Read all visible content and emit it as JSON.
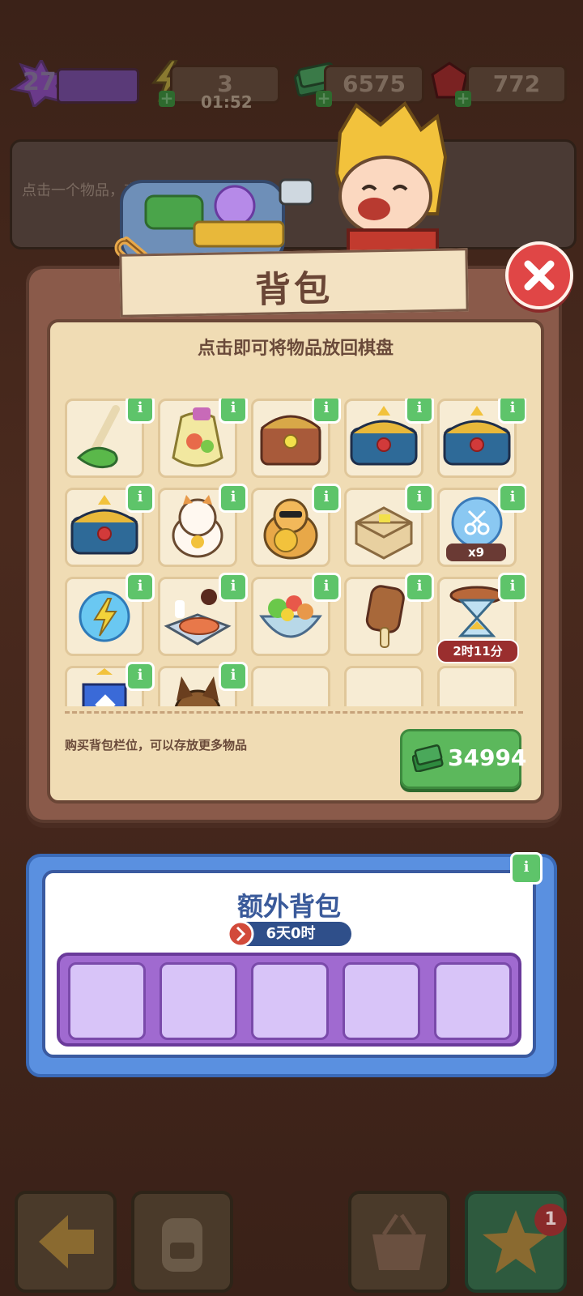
{
  "hud": {
    "level": "27",
    "energy": "3",
    "energy_timer": "01:52",
    "cash": "6575",
    "gems": "772"
  },
  "background_hint": "点击一个物品，查看它的信息",
  "backpack": {
    "title": "背包",
    "subtitle": "点击即可将物品放回棋盘",
    "info_label": "i",
    "items": [
      {
        "icon": "green-mop-icon"
      },
      {
        "icon": "seed-bag-icon"
      },
      {
        "icon": "treasure-chest-icon"
      },
      {
        "icon": "royal-chest-icon"
      },
      {
        "icon": "royal-chest-icon"
      },
      {
        "icon": "royal-chest-icon"
      },
      {
        "icon": "lucky-cat-icon"
      },
      {
        "icon": "lucky-cat-gold-icon"
      },
      {
        "icon": "wooden-crate-icon"
      },
      {
        "icon": "scissors-bubble-icon",
        "count": "x9"
      },
      {
        "icon": "energy-orb-icon"
      },
      {
        "icon": "fish-dinner-icon"
      },
      {
        "icon": "salad-bowl-icon"
      },
      {
        "icon": "ice-cream-bar-icon"
      },
      {
        "icon": "hourglass-icon",
        "timer": "2时11分"
      },
      {
        "icon": "blue-shield-icon"
      },
      {
        "icon": "dog-icon"
      },
      {
        "icon": null
      },
      {
        "icon": null
      },
      {
        "icon": null
      }
    ],
    "buy_text": "购买背包栏位，可以存放更多物品",
    "buy_price": "34994"
  },
  "extra_backpack": {
    "title": "额外背包",
    "timer": "6天0时",
    "slots": 5
  },
  "nav": {
    "badge_count": "1"
  },
  "colors": {
    "panel_brown": "#8a5a4a",
    "cream": "#f0dcb4",
    "info_green": "#5ec46a",
    "close_red": "#e04646",
    "extra_blue": "#5a90e0",
    "slot_purple": "#d8c4f8"
  }
}
